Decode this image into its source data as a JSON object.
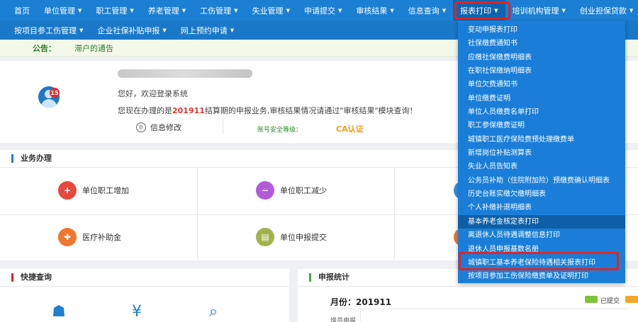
{
  "nav_row1": [
    {
      "label": "首页",
      "caret": false
    },
    {
      "label": "单位管理",
      "caret": true
    },
    {
      "label": "职工管理",
      "caret": true
    },
    {
      "label": "养老管理",
      "caret": true
    },
    {
      "label": "工伤管理",
      "caret": true
    },
    {
      "label": "失业管理",
      "caret": true
    },
    {
      "label": "申请提交",
      "caret": true
    },
    {
      "label": "审核结果",
      "caret": true
    },
    {
      "label": "信息查询",
      "caret": true
    },
    {
      "label": "报表打印",
      "caret": true
    },
    {
      "label": "培训机构管理",
      "caret": true
    },
    {
      "label": "创业担保贷款",
      "caret": true
    }
  ],
  "nav_row2": [
    {
      "label": "按项目参工伤管理",
      "caret": true
    },
    {
      "label": "企业社保补贴申报",
      "caret": true
    },
    {
      "label": "网上预约申请",
      "caret": true
    }
  ],
  "caret_glyph": "▼",
  "notice": {
    "label": "公告：",
    "text": "滞户的通告"
  },
  "profile": {
    "badge_count": "15",
    "greeting": "您好，欢迎登录系统",
    "period_prefix": "您现在办理的是",
    "period_value": "201911",
    "period_suffix": "结算期的申报业务,审核结果情况请通过\"审核结果\"模块查询！",
    "info_edit": "信息修改",
    "security_label": "账号安全等级：",
    "ca_label": "CA认证"
  },
  "business": {
    "title": "业务办理",
    "items": [
      {
        "label": "单位职工增加",
        "icon": "add-user-icon",
        "glyph": "+"
      },
      {
        "label": "单位职工减少",
        "icon": "remove-user-icon",
        "glyph": "−"
      },
      {
        "label": "医疗补助金",
        "icon": "medical-icon",
        "glyph": "✚"
      },
      {
        "label": "单位申报提交",
        "icon": "document-icon",
        "glyph": "▤"
      }
    ]
  },
  "quick": {
    "title": "快捷查询"
  },
  "stats": {
    "title": "申报统计",
    "month_label": "月份：201911",
    "legend_submitted": "已提交",
    "truncated_row": "增员申报"
  },
  "dropdown": {
    "items": [
      "变动申报表打印",
      "社保缴费通知书",
      "应缴社保缴费明细表",
      "在职社保缴纳明细表",
      "单位欠费通知书",
      "单位缴费证明",
      "单位人员缴费名单打印",
      "职工参保缴费证明",
      "城镇职工医疗保险费预处理缴费单",
      "新增岗位补贴测算表",
      "失业人员告知表",
      "公务员补助（住院附加险）预缴费确认明细表",
      "历史台账实缴欠缴明细表",
      "个人补缴补退明细表",
      "基本养老金核定表打印",
      "离退休人员待遇调整信息打印",
      "退休人员申报基数名册",
      "城镇职工基本养老保险待遇相关报表打印",
      "按项目参加工伤保险缴费单及证明打印"
    ],
    "hover_index": 14
  },
  "colors": {
    "nav": "#1b7fd3",
    "dropdown": "#1a7ed8",
    "highlight": "#e02424",
    "legend_green": "#7cc43a",
    "legend_orange": "#f5a623"
  }
}
